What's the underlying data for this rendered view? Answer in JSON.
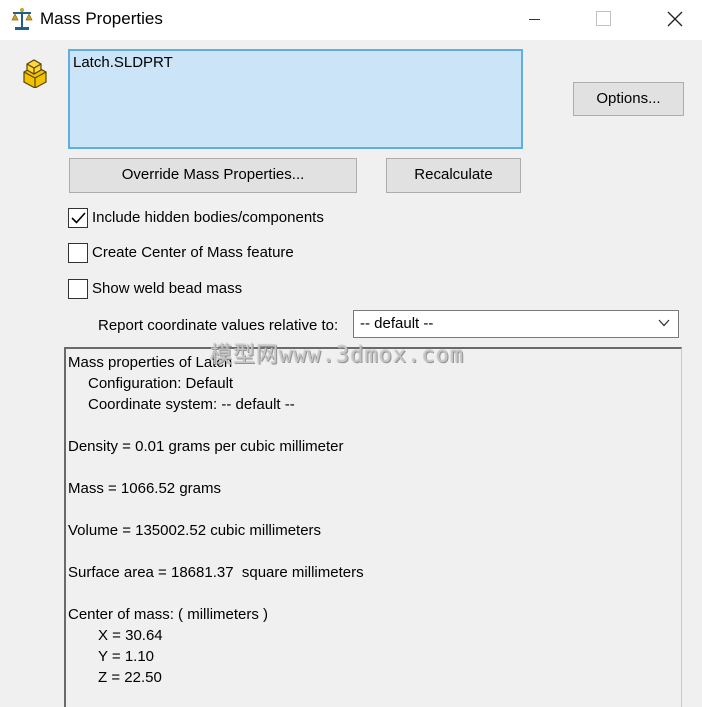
{
  "window": {
    "title": "Mass Properties",
    "controls": {
      "minimize": "minimize",
      "maximize": "maximize",
      "close": "close"
    }
  },
  "selection": {
    "items": [
      "Latch.SLDPRT"
    ]
  },
  "buttons": {
    "options": "Options...",
    "override": "Override Mass Properties...",
    "recalculate": "Recalculate"
  },
  "checkboxes": [
    {
      "label": "Include hidden bodies/components",
      "checked": true
    },
    {
      "label": "Create Center of Mass feature",
      "checked": false
    },
    {
      "label": "Show weld bead mass",
      "checked": false
    }
  ],
  "coordinate": {
    "label": "Report coordinate values relative to:",
    "selected": "-- default --"
  },
  "results": {
    "header": "Mass properties of Latch",
    "configuration": "Configuration: Default",
    "coord_system": "Coordinate system: -- default --",
    "density": "Density = 0.01 grams per cubic millimeter",
    "mass": "Mass = 1066.52 grams",
    "volume": "Volume = 135002.52 cubic millimeters",
    "surface_area": "Surface area = 18681.37  square millimeters",
    "center_of_mass": "Center of mass: ( millimeters )",
    "x": "X = 30.64",
    "y": "Y = 1.10",
    "z": "Z = 22.50"
  },
  "watermark": "模型网www.3dmox.com",
  "colors": {
    "accent": "#5fb0e0",
    "selection_fill": "#cce4f7",
    "dialog_bg": "#f0f0f0",
    "button_bg": "#e1e1e1"
  },
  "icons": {
    "title": "balance-scale-icon",
    "part": "part-block-icon",
    "checkbox": "check-icon",
    "dropdown": "chevron-down-icon"
  }
}
